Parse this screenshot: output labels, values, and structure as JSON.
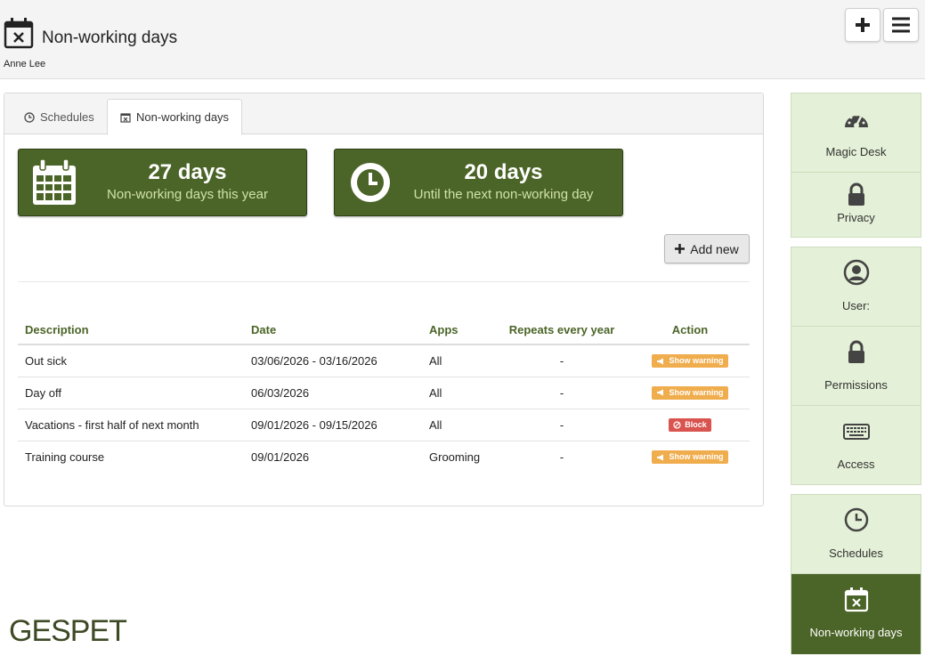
{
  "header": {
    "title": "Non-working days",
    "user": "Anne Lee",
    "page_icon": "calendar-x-icon",
    "add_icon": "plus-icon",
    "menu_icon": "hamburger-icon"
  },
  "tabs": [
    {
      "label": "Schedules",
      "icon": "clock-icon",
      "active": false
    },
    {
      "label": "Non-working days",
      "icon": "calendar-x-icon",
      "active": true
    }
  ],
  "stats": [
    {
      "value": "27 days",
      "caption": "Non-working days this year",
      "icon": "calendar-icon"
    },
    {
      "value": "20 days",
      "caption": "Until the next non-working day",
      "icon": "clock-icon"
    }
  ],
  "add_new_label": "Add new",
  "table": {
    "columns": [
      "Description",
      "Date",
      "Apps",
      "Repeats every year",
      "Action"
    ],
    "rows": [
      {
        "description": "Out sick",
        "date": "03/06/2026 - 03/16/2026",
        "apps": "All",
        "repeats": "-",
        "action": "Show warning",
        "action_type": "warning"
      },
      {
        "description": "Day off",
        "date": "06/03/2026",
        "apps": "All",
        "repeats": "-",
        "action": "Show warning",
        "action_type": "warning"
      },
      {
        "description": "Vacations - first half of next month",
        "date": "09/01/2026 - 09/15/2026",
        "apps": "All",
        "repeats": "-",
        "action": "Block",
        "action_type": "block"
      },
      {
        "description": "Training course",
        "date": "09/01/2026",
        "apps": "Grooming",
        "repeats": "-",
        "action": "Show warning",
        "action_type": "warning"
      }
    ]
  },
  "sidebar": {
    "groups": [
      [
        {
          "label": "Magic Desk",
          "icon": "gauge-icon"
        },
        {
          "label": "Privacy",
          "icon": "lock-icon"
        }
      ],
      [
        {
          "label": "User:",
          "icon": "user-circle-icon"
        },
        {
          "label": "Permissions",
          "icon": "lock-icon"
        },
        {
          "label": "Access",
          "icon": "keyboard-icon"
        }
      ],
      [
        {
          "label": "Schedules",
          "icon": "clock-icon"
        },
        {
          "label": "Non-working days",
          "icon": "calendar-x-icon",
          "active": true
        }
      ]
    ]
  },
  "logo": "GESPET",
  "colors": {
    "primary": "#4b6427",
    "sidebar_bg": "#e4f0d7",
    "warning": "#f0ad4e",
    "danger": "#d9534f"
  }
}
